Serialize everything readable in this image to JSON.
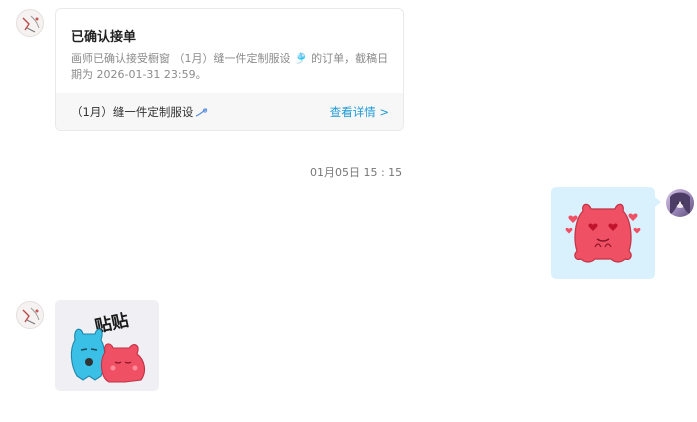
{
  "order_card": {
    "title": "已确认接单",
    "description": "画师已确认接受橱窗 （1月）缝一件定制服设 🎐 的订单，截稿日期为 2026-01-31 23:59。",
    "product_name": "（1月）缝一件定制服设",
    "view_details_label": "查看详情 >"
  },
  "timestamp": "01月05日 15 : 15",
  "stickers": {
    "right_sticker_text": "",
    "left_sticker_text": "贴贴"
  },
  "colors": {
    "link": "#1f9ad6",
    "right_bubble": "#d8f1fd",
    "left_bubble": "#efeff4",
    "sticker_red": "#f05064",
    "sticker_blue": "#3ac0e6"
  }
}
